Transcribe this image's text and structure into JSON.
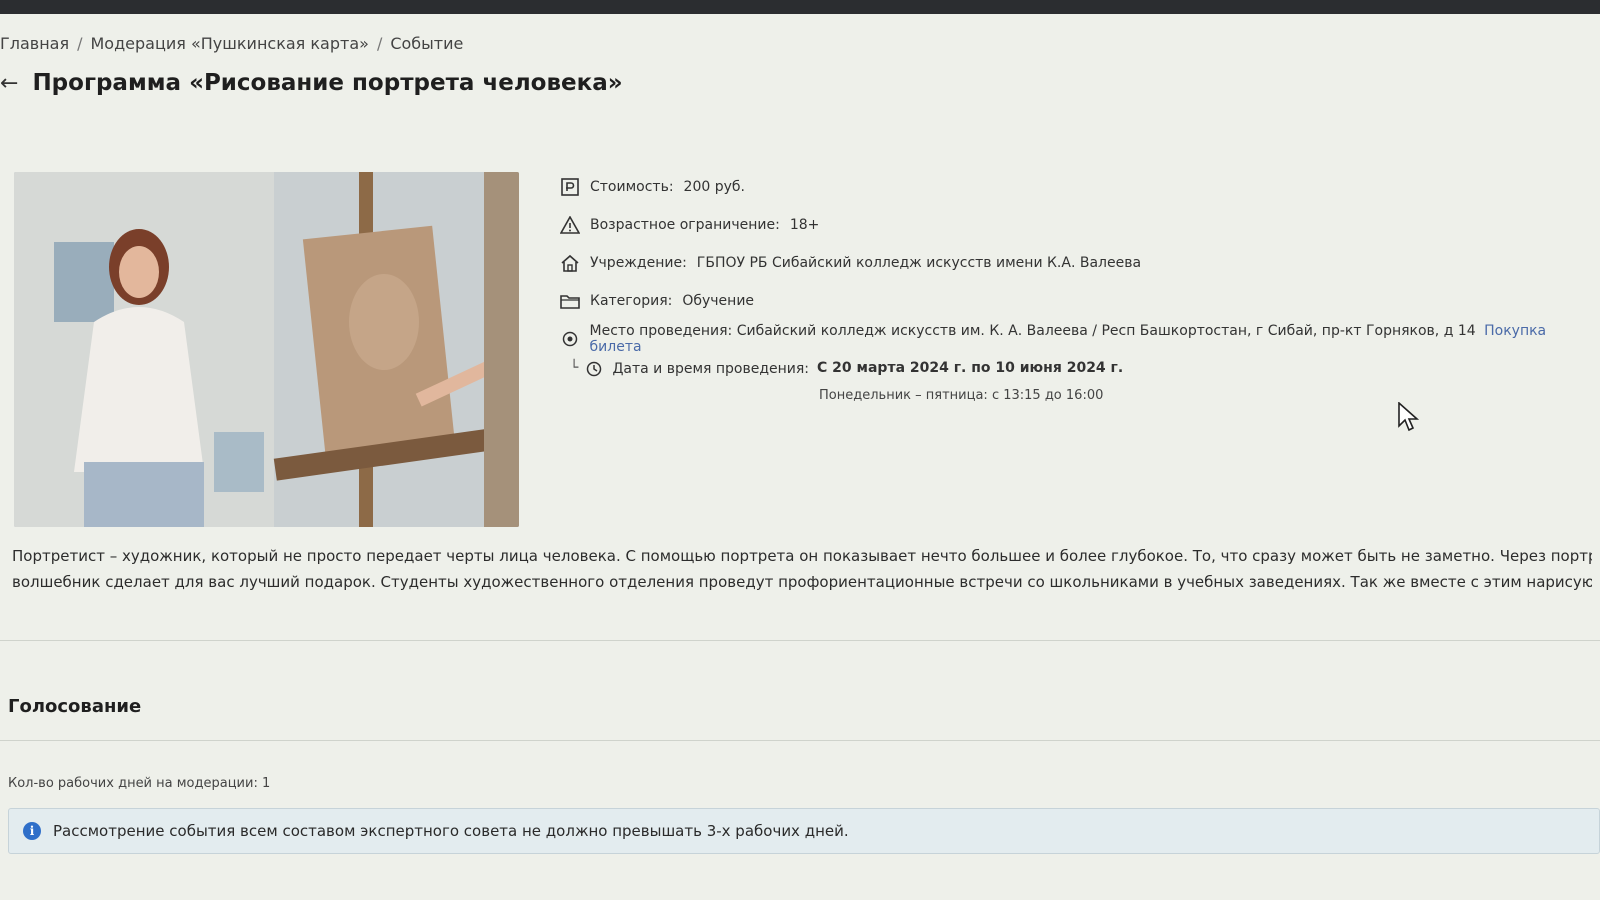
{
  "breadcrumb": {
    "home": "Главная",
    "moderation": "Модерация «Пушкинская карта»",
    "current": "Событие",
    "separator": "/"
  },
  "header": {
    "back_icon": "arrow-left-icon",
    "title": "Программа «Рисование портрета человека»"
  },
  "event_info": {
    "cost": {
      "label": "Стоимость:",
      "value": "200 руб.",
      "icon": "ruble-icon"
    },
    "age": {
      "label": "Возрастное ограничение:",
      "value": "18+",
      "icon": "warning-icon"
    },
    "institution": {
      "label": "Учреждение:",
      "value": "ГБПОУ РБ Сибайский колледж искусств имени К.А. Валеева",
      "icon": "home-icon"
    },
    "category": {
      "label": "Категория:",
      "value": "Обучение",
      "icon": "folder-icon"
    },
    "venue": {
      "label": "Место проведения:",
      "value": "Сибайский колледж искусств им. К. А. Валеева / Респ Башкортостан, г Сибай, пр-кт Горняков, д 14",
      "link": "Покупка билета",
      "icon": "location-icon"
    },
    "datetime": {
      "label": "Дата и время проведения:",
      "value": "С 20 марта 2024 г. по 10 июня 2024 г.",
      "schedule": "Понедельник – пятница: с 13:15 до 16:00",
      "icon": "clock-icon"
    }
  },
  "description": {
    "line1": "Портретист – художник, который не просто передает черты лица человека. С помощью портрета он показывает нечто большее и более глубокое. То, что сразу может быть не заметно. Через портрет художник",
    "line2": "волшебник сделает для вас лучший подарок. Студенты художественного отделения проведут профориентационные встречи со школьниками в учебных заведениях. Так же вместе с этим нарисуют учащихся"
  },
  "voting": {
    "title": "Голосование",
    "moderation_days": "Кол-во рабочих дней на модерации: 1",
    "notice": "Рассмотрение события всем составом экспертного совета не должно превышать 3-х рабочих дней.",
    "notice_icon": "info-icon"
  }
}
